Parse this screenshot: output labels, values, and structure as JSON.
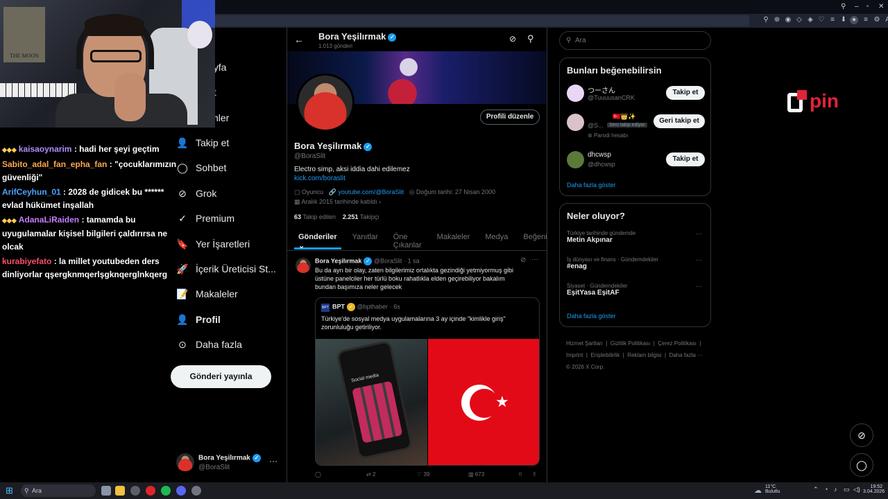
{
  "logo_text": "pin",
  "chat": [
    {
      "user": "kaisaoynarim",
      "color": "#b18cff",
      "message": ": hadi her şeyi geçtim"
    },
    {
      "user": "Sabito_adal_fan_epha_fan",
      "color": "#ffa64d",
      "message": ": \"çocuklarımızın güvenliği\""
    },
    {
      "user": "ArifCeyhun_01",
      "color": "#4da3ff",
      "message": ": 2028 de gidicek bu ****** evlad hükümet inşallah"
    },
    {
      "user": "AdanaLiRaiden",
      "color": "#c77dff",
      "message": ": tamamda bu uyugulamalar kişisel bilgileri çaldırırsa ne olcak"
    },
    {
      "user": "kurabiyefato",
      "color": "#ff4d6a",
      "message": ": la millet youtubeden ders dinliyorlar qşergknmqerlşgknqerglnkqerg"
    }
  ],
  "nav": {
    "partial1": "ayfa",
    "partial2": "et",
    "partial3": "imler",
    "follow": "Takip et",
    "chat": "Sohbet",
    "grok": "Grok",
    "premium": "Premium",
    "bookmarks": "Yer İşaretleri",
    "creator": "İçerik Üreticisi St...",
    "articles": "Makaleler",
    "profile": "Profil",
    "more": "Daha fazla",
    "post_button": "Gönderi yayınla"
  },
  "account": {
    "name": "Bora Yeşilırmak",
    "handle": "@BoraSlit"
  },
  "header": {
    "name": "Bora Yeşilırmak",
    "posts": "1.013 gönderi"
  },
  "profile": {
    "edit_button": "Profili düzenle",
    "name": "Bora Yeşilırmak",
    "handle": "@BoraSlit",
    "bio": "Electro simp, aksi iddia dahi edilemez",
    "bio_link": "kick.com/boraslit",
    "category": "Oyuncu",
    "website": "youtube.com/@BoraSlit",
    "birthday": "Doğum tarihi: 27 Nisan 2000",
    "joined": "Aralık 2015 tarihinde katıldı",
    "following_count": "63",
    "following_label": "Takip edilen",
    "followers_count": "2.251",
    "followers_label": "Takipçi"
  },
  "tabs": [
    "Gönderiler",
    "Yanıtlar",
    "Öne Çıkanlar",
    "Makaleler",
    "Medya",
    "Beğeni"
  ],
  "post": {
    "author": "Bora Yeşilırmak",
    "handle": "@BoraSlit",
    "time": "· 1 sa",
    "text": "Bu da ayrı bir olay, zaten bilgilerimiz ortalıkta gezindiği yetmiyormuş gibi üstüne panelciler her türlü boku rahatlıkla elden geçirebiliyor bakalım bundan başımıza neler gelecek",
    "quote": {
      "author": "BPT",
      "handle": "@bpthaber",
      "time": "· 6s",
      "text": "Türkiye'de sosyal medya uygulamalarına 3 ay içinde \"kimlikle giriş\" zorunluluğu getiriliyor.",
      "phone_label": "Social media"
    },
    "retweets": "2",
    "likes": "39",
    "views": "673"
  },
  "search_placeholder": "Ara",
  "suggestions": {
    "title": "Bunları beğenebilirsin",
    "items": [
      {
        "name": "つーさん",
        "handle": "@TuuuusanCRK",
        "button": "Takip et"
      },
      {
        "name": "🇹🇷👑✨",
        "handle": "@S...",
        "badge": "Seni takip ediyor",
        "note": "Parodi hesabı",
        "button": "Geri takip et"
      },
      {
        "name": "dhcwsp",
        "handle": "@dhcwsp",
        "button": "Takip et"
      }
    ],
    "show_more": "Daha fazla göster"
  },
  "trends": {
    "title": "Neler oluyor?",
    "items": [
      {
        "meta": "Türkiye tarihinde gündemde",
        "name": "Metin Akpınar"
      },
      {
        "meta": "İş dünyası ve finans · Gündemdekiler",
        "name": "#enag"
      },
      {
        "meta": "Siyaset · Gündemdekiler",
        "name": "EşitYasa EşitAF"
      }
    ],
    "show_more": "Daha fazla göster"
  },
  "footer": [
    "Hizmet Şartları",
    "|",
    "Gizlilik Politikası",
    "|",
    "Çerez Politikası",
    "|",
    "Imprint",
    "|",
    "Erişilebilirlik",
    "|",
    "Reklam bilgisi",
    "|",
    "Daha fazla ···",
    "© 2026 X Corp."
  ],
  "taskbar": {
    "search": "Ara",
    "weather_temp": "11°C",
    "weather_desc": "Bulutlu",
    "time": "19:52",
    "date": "3.04.2026"
  }
}
